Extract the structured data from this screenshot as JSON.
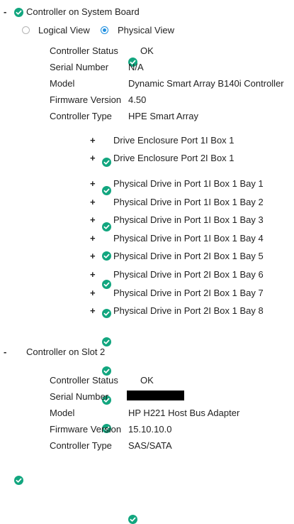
{
  "controllers": [
    {
      "toggle": "-",
      "title": "Controller on System Board",
      "views": {
        "logical": "Logical View",
        "physical": "Physical View",
        "selected": "physical"
      },
      "details": [
        {
          "label": "Controller Status",
          "value": "OK",
          "status_icon": "check-circle-icon"
        },
        {
          "label": "Serial Number",
          "value": "N/A"
        },
        {
          "label": "Model",
          "value": "Dynamic Smart Array B140i Controller"
        },
        {
          "label": "Firmware Version",
          "value": "4.50"
        },
        {
          "label": "Controller Type",
          "value": "HPE Smart Array"
        }
      ],
      "enclosures": [
        {
          "toggle": "+",
          "label": "Drive Enclosure Port 1I Box 1"
        },
        {
          "toggle": "+",
          "label": "Drive Enclosure Port 2I Box 1"
        }
      ],
      "drives": [
        {
          "toggle": "+",
          "label": "Physical Drive in Port 1I Box 1 Bay 1"
        },
        {
          "toggle": "+",
          "label": "Physical Drive in Port 1I Box 1 Bay 2"
        },
        {
          "toggle": "+",
          "label": "Physical Drive in Port 1I Box 1 Bay 3"
        },
        {
          "toggle": "+",
          "label": "Physical Drive in Port 1I Box 1 Bay 4"
        },
        {
          "toggle": "+",
          "label": "Physical Drive in Port 2I Box 1 Bay 5"
        },
        {
          "toggle": "+",
          "label": "Physical Drive in Port 2I Box 1 Bay 6"
        },
        {
          "toggle": "+",
          "label": "Physical Drive in Port 2I Box 1 Bay 7"
        },
        {
          "toggle": "+",
          "label": "Physical Drive in Port 2I Box 1 Bay 8"
        }
      ]
    },
    {
      "toggle": "-",
      "title": "Controller on Slot 2",
      "details": [
        {
          "label": "Controller Status",
          "value": "OK",
          "status_icon": "check-circle-icon"
        },
        {
          "label": "Serial Number",
          "value": "",
          "redacted": true
        },
        {
          "label": "Model",
          "value": "HP H221 Host Bus Adapter"
        },
        {
          "label": "Firmware Version",
          "value": "15.10.10.0"
        },
        {
          "label": "Controller Type",
          "value": "SAS/SATA"
        }
      ]
    }
  ],
  "colors": {
    "ok_green": "#12a67f",
    "radio_blue": "#1f8fe0",
    "text": "#222222"
  }
}
